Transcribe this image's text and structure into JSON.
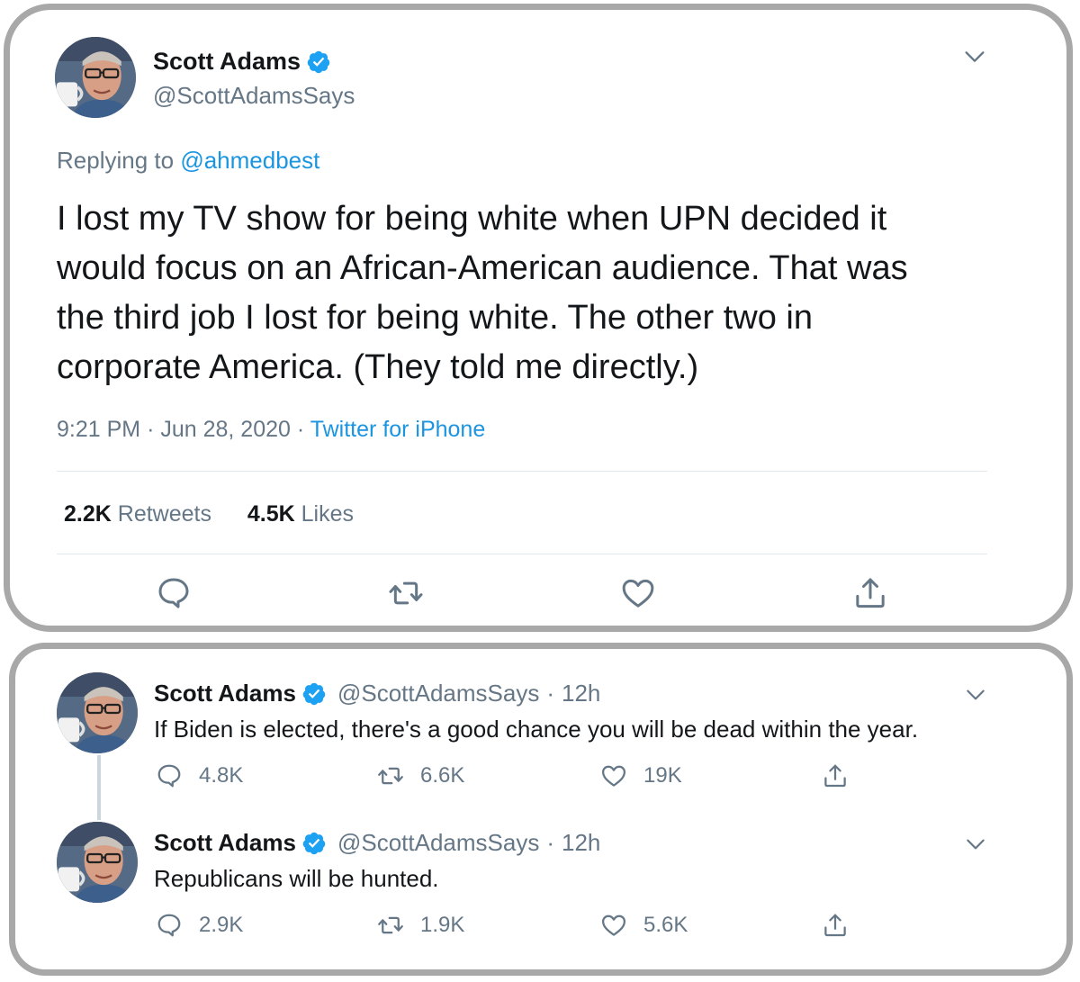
{
  "main_tweet": {
    "author": {
      "name": "Scott Adams",
      "handle": "@ScottAdamsSays",
      "verified": true,
      "avatar": "avatar-man-with-mug"
    },
    "reply_prefix": "Replying to",
    "reply_to": "@ahmedbest",
    "text_lines": [
      "I lost my TV show for being white when UPN decided it",
      "would focus on an African-American audience. That was",
      "the third job I lost for being white. The other two in",
      "corporate America. (They told me directly.)"
    ],
    "time": "9:21 PM",
    "sep1": "·",
    "date": "Jun 28, 2020",
    "sep2": "·",
    "source": "Twitter for iPhone",
    "stats": {
      "retweets_count": "2.2K",
      "retweets_label": "Retweets",
      "likes_count": "4.5K",
      "likes_label": "Likes"
    },
    "actions": [
      "reply-icon",
      "retweet-icon",
      "like-icon",
      "share-icon"
    ]
  },
  "thread": [
    {
      "name": "Scott Adams",
      "handle": "@ScottAdamsSays",
      "sep": "·",
      "time": "12h",
      "text": "If Biden is elected, there's a good chance you will be dead within the year.",
      "replies": "4.8K",
      "retweets": "6.6K",
      "likes": "19K"
    },
    {
      "name": "Scott Adams",
      "handle": "@ScottAdamsSays",
      "sep": "·",
      "time": "12h",
      "text": "Republicans will be hunted.",
      "replies": "2.9K",
      "retweets": "1.9K",
      "likes": "5.6K"
    }
  ],
  "colors": {
    "accent": "#1b95e0",
    "muted": "#657786",
    "text": "#14171a",
    "card_border": "#a8a8a8"
  }
}
